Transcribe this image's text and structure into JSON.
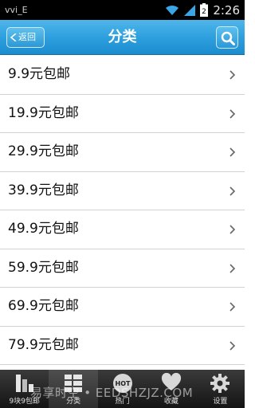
{
  "status_bar": {
    "time": "2:26",
    "notification_text": "vvi_E",
    "battery_level": "2"
  },
  "header": {
    "back_label": "返回",
    "title": "分类"
  },
  "list": [
    {
      "label": "9.9元包邮"
    },
    {
      "label": "19.9元包邮"
    },
    {
      "label": "29.9元包邮"
    },
    {
      "label": "39.9元包邮"
    },
    {
      "label": "49.9元包邮"
    },
    {
      "label": "59.9元包邮"
    },
    {
      "label": "69.9元包邮"
    },
    {
      "label": "79.9元包邮"
    }
  ],
  "tabs": [
    {
      "label": "9块9包邮",
      "icon": "grid-icon"
    },
    {
      "label": "分类",
      "icon": "list-icon",
      "active": true
    },
    {
      "label": "热门",
      "icon": "hot-icon",
      "badge": "HOT"
    },
    {
      "label": "收藏",
      "icon": "heart-icon"
    },
    {
      "label": "设置",
      "icon": "gear-icon"
    }
  ],
  "watermark": "易享时空 • EEDSHZJZ.COM",
  "colors": {
    "header_blue": "#2ea0de",
    "tabbar_dark": "#1e1e1e"
  }
}
